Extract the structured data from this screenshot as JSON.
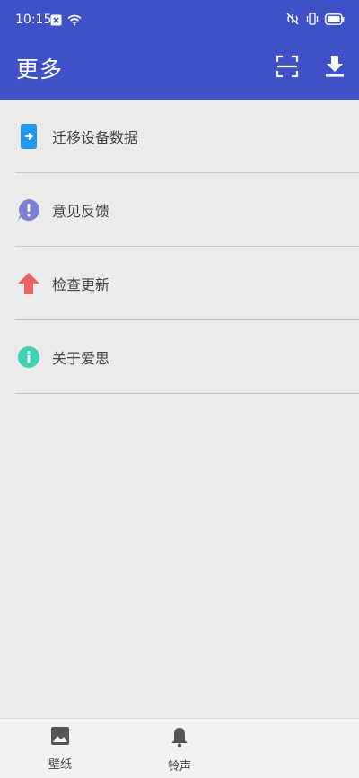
{
  "status_bar": {
    "time": "10:15"
  },
  "header": {
    "title": "更多",
    "scan_icon": "scan-icon",
    "download_icon": "download-icon"
  },
  "menu": {
    "items": [
      {
        "label": "迁移设备数据",
        "icon": "transfer-icon",
        "color": "#2196f3"
      },
      {
        "label": "意见反馈",
        "icon": "feedback-icon",
        "color": "#7b7fd6"
      },
      {
        "label": "检查更新",
        "icon": "update-arrow-icon",
        "color": "#e96363"
      },
      {
        "label": "关于爱思",
        "icon": "info-icon",
        "color": "#3fd1b3"
      }
    ]
  },
  "bottom_nav": {
    "items": [
      {
        "label": "壁纸",
        "icon": "wallpaper-icon"
      },
      {
        "label": "铃声",
        "icon": "bell-icon"
      }
    ]
  },
  "colors": {
    "app_bar": "#3f51c7",
    "background": "#ebebeb"
  }
}
